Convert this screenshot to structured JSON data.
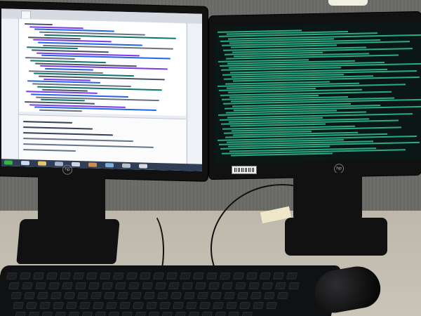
{
  "scene": {
    "kind": "photo",
    "partition_color": "#6b6c67",
    "desk_color": "#c5c0b3"
  },
  "left_monitor": {
    "brand_logo": "hp"
  },
  "right_monitor": {
    "brand_logo": "hp",
    "text_color": "#2fd1a1"
  }
}
